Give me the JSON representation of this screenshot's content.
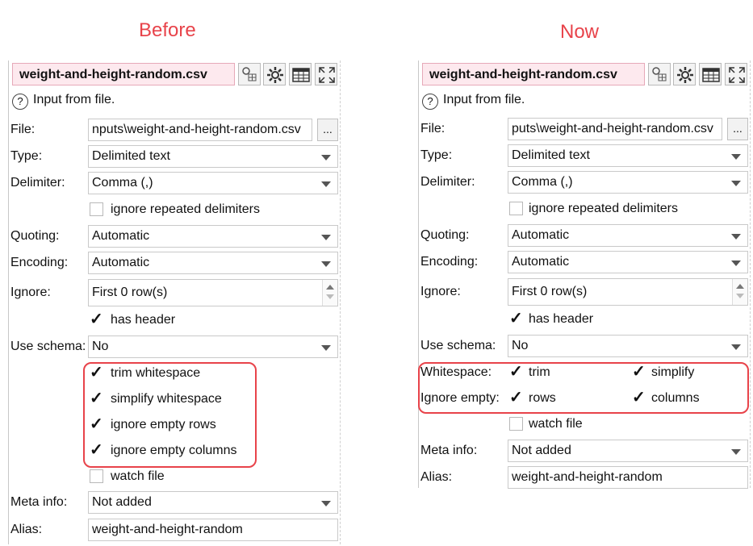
{
  "headings": {
    "before": "Before",
    "now": "Now"
  },
  "before": {
    "title": "weight-and-height-random.csv",
    "info": "Input from file.",
    "file_label": "File:",
    "file_value": "nputs\\weight-and-height-random.csv",
    "browse": "...",
    "type_label": "Type:",
    "type_value": "Delimited text",
    "delimiter_label": "Delimiter:",
    "delimiter_value": "Comma (,)",
    "ignore_repeated": "ignore repeated delimiters",
    "quoting_label": "Quoting:",
    "quoting_value": "Automatic",
    "encoding_label": "Encoding:",
    "encoding_value": "Automatic",
    "ignore_label": "Ignore:",
    "ignore_value": "First 0 row(s)",
    "has_header": "has header",
    "schema_label": "Use schema:",
    "schema_value": "No",
    "trim_ws": "trim whitespace",
    "simplify_ws": "simplify whitespace",
    "ignore_rows": "ignore empty rows",
    "ignore_cols": "ignore empty columns",
    "watch_file": "watch file",
    "meta_label": "Meta info:",
    "meta_value": "Not added",
    "alias_label": "Alias:",
    "alias_value": "weight-and-height-random"
  },
  "now": {
    "title": "weight-and-height-random.csv",
    "info": "Input from file.",
    "file_label": "File:",
    "file_value": "puts\\weight-and-height-random.csv",
    "browse": "...",
    "type_label": "Type:",
    "type_value": "Delimited text",
    "delimiter_label": "Delimiter:",
    "delimiter_value": "Comma (,)",
    "ignore_repeated": "ignore repeated delimiters",
    "quoting_label": "Quoting:",
    "quoting_value": "Automatic",
    "encoding_label": "Encoding:",
    "encoding_value": "Automatic",
    "ignore_label": "Ignore:",
    "ignore_value": "First 0 row(s)",
    "has_header": "has header",
    "schema_label": "Use schema:",
    "schema_value": "No",
    "whitespace_label": "Whitespace:",
    "trim": "trim",
    "simplify": "simplify",
    "ignore_empty_label": "Ignore empty:",
    "rows": "rows",
    "columns": "columns",
    "watch_file": "watch file",
    "meta_label": "Meta info:",
    "meta_value": "Not added",
    "alias_label": "Alias:",
    "alias_value": "weight-and-height-random"
  },
  "colors": {
    "highlight": "#e8434a",
    "title_bg": "#fde9ee"
  },
  "icons": [
    "properties-icon",
    "settings-gear-icon",
    "table-view-icon",
    "expand-icon",
    "help-icon",
    "checkmark-icon",
    "dropdown-arrow-icon"
  ]
}
